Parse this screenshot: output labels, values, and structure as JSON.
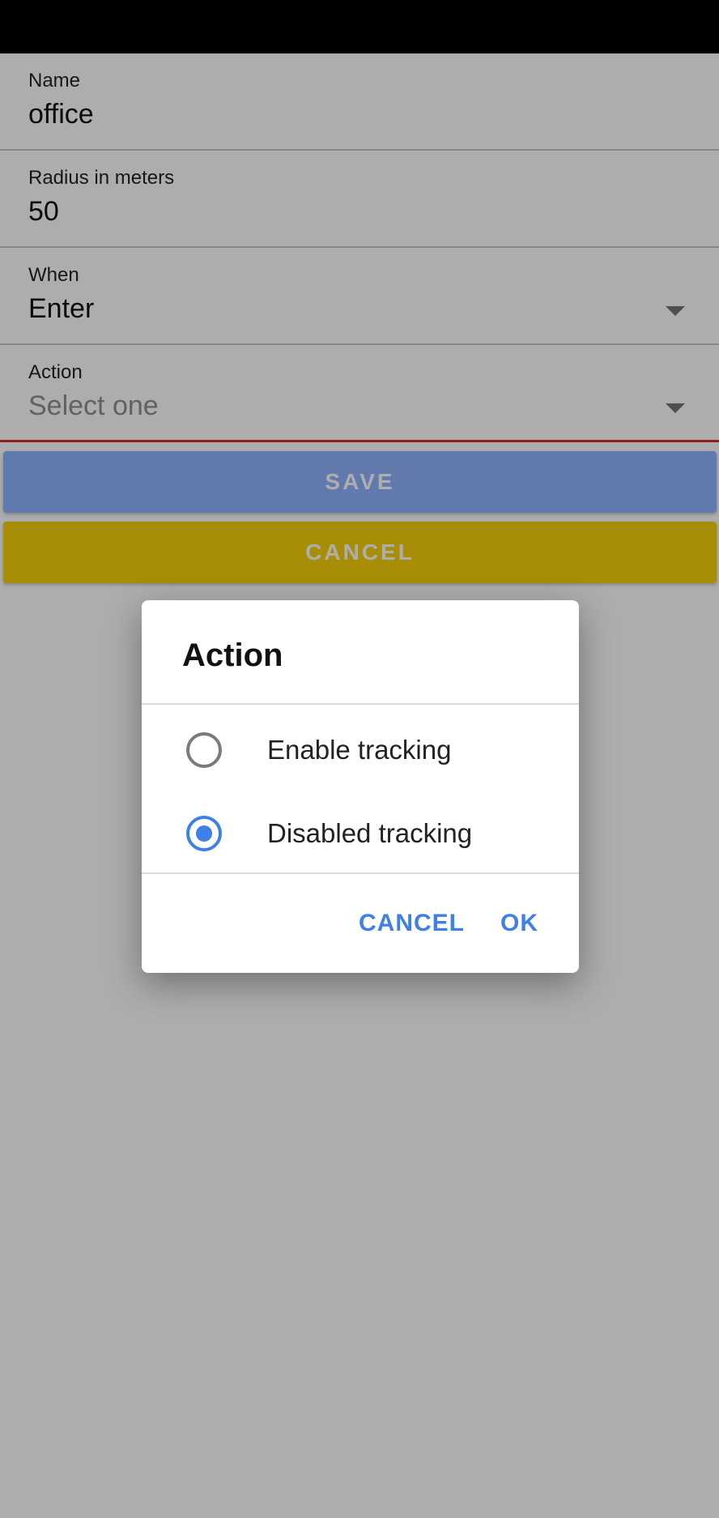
{
  "form": {
    "name": {
      "label": "Name",
      "value": "office"
    },
    "radius": {
      "label": "Radius in meters",
      "value": "50"
    },
    "when": {
      "label": "When",
      "value": "Enter"
    },
    "action": {
      "label": "Action",
      "placeholder": "Select one"
    }
  },
  "buttons": {
    "save_label": "SAVE",
    "cancel_label": "CANCEL"
  },
  "dialog": {
    "title": "Action",
    "options": [
      {
        "label": "Enable tracking",
        "selected": false
      },
      {
        "label": "Disabled tracking",
        "selected": true
      }
    ],
    "cancel_label": "CANCEL",
    "ok_label": "OK"
  },
  "colors": {
    "accent": "#3f7fe8",
    "save_button": "#8fb4ff",
    "cancel_button": "#f8d10a",
    "error_underline": "#d32f2f"
  },
  "icons": [
    "dropdown-arrow-icon",
    "radio-unchecked-icon",
    "radio-checked-icon"
  ]
}
